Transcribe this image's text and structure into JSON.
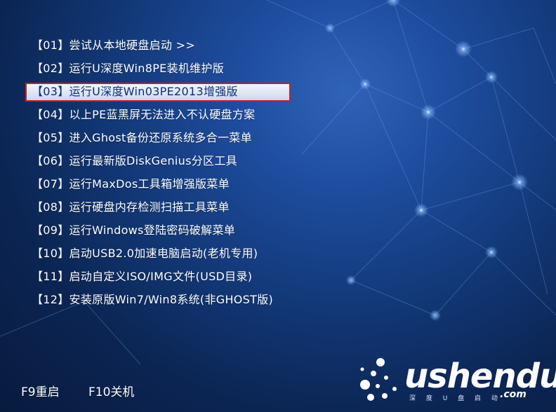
{
  "menu": {
    "items": [
      {
        "label": "【01】尝试从本地硬盘启动 >>"
      },
      {
        "label": "【02】运行U深度Win8PE装机维护版"
      },
      {
        "label": "【03】运行U深度Win03PE2013增强版"
      },
      {
        "label": "【04】以上PE蓝黑屏无法进入不认硬盘方案"
      },
      {
        "label": "【05】进入Ghost备份还原系统多合一菜单"
      },
      {
        "label": "【06】运行最新版DiskGenius分区工具"
      },
      {
        "label": "【07】运行MaxDos工具箱增强版菜单"
      },
      {
        "label": "【08】运行硬盘内存检测扫描工具菜单"
      },
      {
        "label": "【09】运行Windows登陆密码破解菜单"
      },
      {
        "label": "【10】启动USB2.0加速电脑启动(老机专用)"
      },
      {
        "label": "【11】启动自定义ISO/IMG文件(USD目录)"
      },
      {
        "label": "【12】安装原版Win7/Win8系统(非GHOST版)"
      }
    ],
    "selected_index": 2,
    "selected_highlight_color": "#d01c1c"
  },
  "footer": {
    "f9_label": "F9重启",
    "f10_label": "F10关机"
  },
  "logo": {
    "wordmark": "ushendu",
    "domain": ".com",
    "tagline": "深 度 U 盘 启 动"
  },
  "colors": {
    "background_center": "#2f63b8",
    "background_edge": "#081b3e",
    "text": "#ffffff"
  }
}
